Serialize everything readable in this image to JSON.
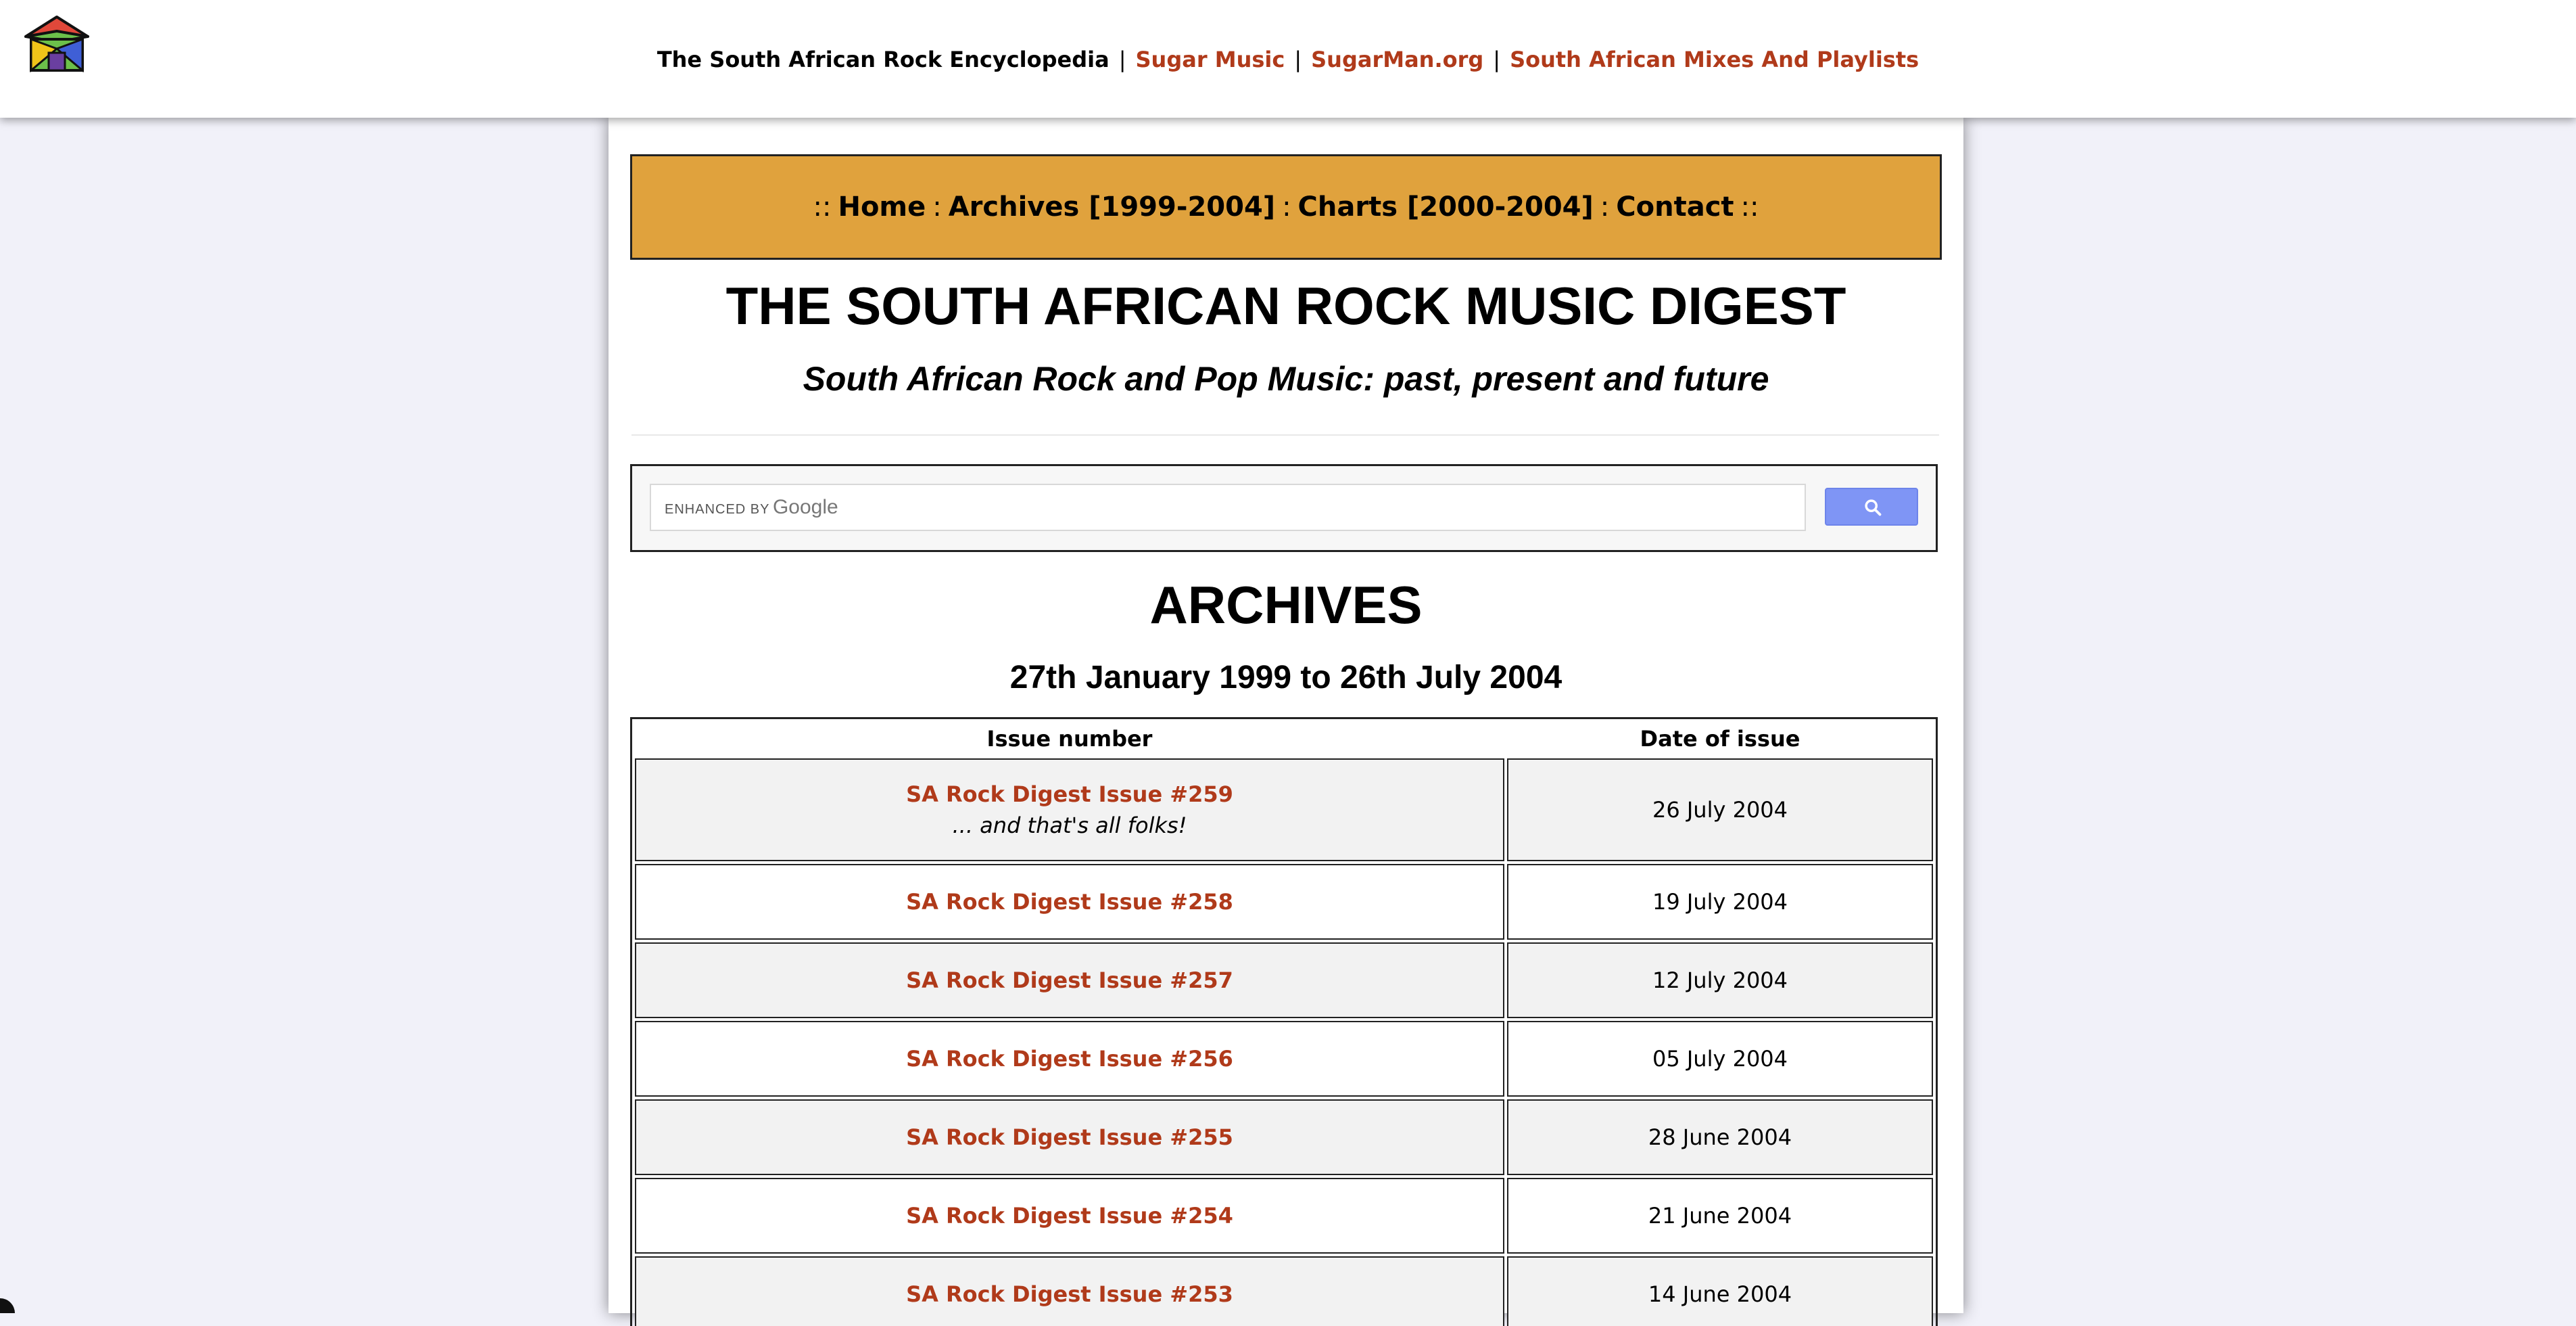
{
  "topbar": {
    "logo_icon": "house-logo-icon",
    "site_name": "The South African Rock Encyclopedia",
    "links": [
      "Sugar Music",
      "SugarMan.org",
      "South African Mixes And Playlists"
    ],
    "separator": "|",
    "link_color": "#b03a1a"
  },
  "nav": {
    "home": "Home",
    "archives": "Archives [1999-2004]",
    "charts": "Charts [2000-2004]",
    "contact": "Contact",
    "lead": "::",
    "sep": ":",
    "trail": "::",
    "bg_color": "#e0a23d"
  },
  "header": {
    "title": "THE SOUTH AFRICAN ROCK MUSIC DIGEST",
    "subtitle": "South African Rock and Pop Music: past, present and future"
  },
  "search": {
    "enhanced_by": "ENHANCED BY",
    "brand": "Google",
    "button_icon": "search-icon",
    "button_color": "#7f95f5"
  },
  "archives": {
    "heading": "ARCHIVES",
    "range": "27th January 1999 to 26th July 2004"
  },
  "table": {
    "headers": [
      "Issue number",
      "Date of issue"
    ],
    "rows": [
      {
        "issue": "SA Rock Digest Issue #259",
        "note": "... and that's all folks!",
        "date": "26 July 2004"
      },
      {
        "issue": "SA Rock Digest Issue #258",
        "date": "19 July 2004"
      },
      {
        "issue": "SA Rock Digest Issue #257",
        "date": "12 July 2004"
      },
      {
        "issue": "SA Rock Digest Issue #256",
        "date": "05 July 2004"
      },
      {
        "issue": "SA Rock Digest Issue #255",
        "date": "28 June 2004"
      },
      {
        "issue": "SA Rock Digest Issue #254",
        "date": "21 June 2004"
      },
      {
        "issue": "SA Rock Digest Issue #253",
        "date": "14 June 2004"
      }
    ]
  }
}
